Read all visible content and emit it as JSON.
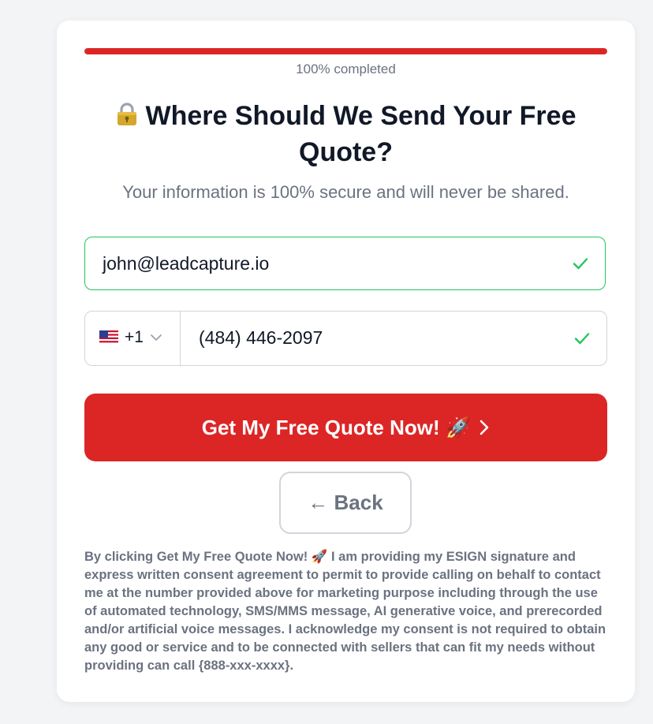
{
  "progress": {
    "percent": 100,
    "label": "100% completed",
    "color": "#dc2626"
  },
  "heading": {
    "icon": "lock-icon",
    "title": "Where Should We Send Your Free Quote?",
    "subtitle": "Your information is 100% secure and will never be shared."
  },
  "form": {
    "email": {
      "value": "john@leadcapture.io",
      "valid": true
    },
    "phone": {
      "country_flag": "us-flag-icon",
      "dial_code": "+1",
      "value": "(484) 446-2097",
      "valid": true
    }
  },
  "actions": {
    "submit_label": "Get My Free Quote Now! 🚀",
    "back_label": "← Back"
  },
  "disclaimer": "By clicking Get My Free Quote Now! 🚀 I am providing my ESIGN signature and express written consent agreement to permit to provide calling on behalf to contact me at the number provided above for marketing purpose including through the use of automated technology, SMS/MMS message, AI generative voice, and prerecorded and/or artificial voice messages. I acknowledge my consent is not required to obtain any good or service and to be connected with sellers that can fit my needs without providing can call {888-xxx-xxxx}.",
  "colors": {
    "accent": "#dc2626",
    "valid": "#22c55e",
    "muted_text": "#6b7280",
    "title_text": "#111827"
  }
}
